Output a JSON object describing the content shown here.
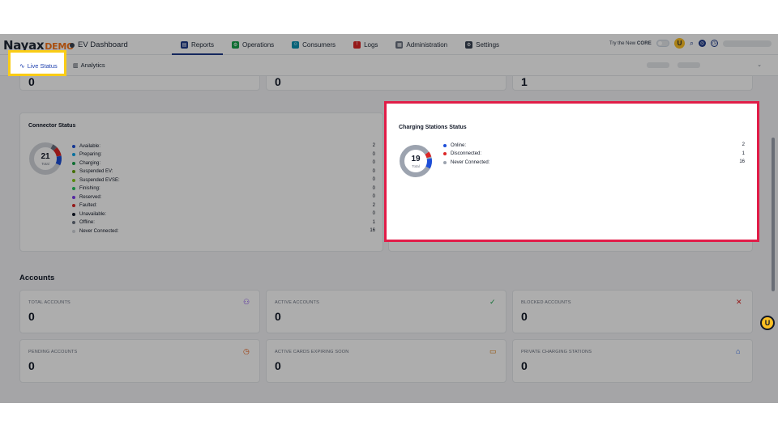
{
  "header": {
    "logo_main": "Nayax",
    "logo_demo": "DEMO",
    "app_title": "EV Dashboard",
    "nav": [
      {
        "label": "Reports",
        "icon": "reports-icon",
        "color": "#1e3a8a",
        "active": true
      },
      {
        "label": "Operations",
        "icon": "operations-icon",
        "color": "#16a34a"
      },
      {
        "label": "Consumers",
        "icon": "consumers-icon",
        "color": "#0891b2"
      },
      {
        "label": "Logs",
        "icon": "logs-icon",
        "color": "#dc2626"
      },
      {
        "label": "Administration",
        "icon": "administration-icon",
        "color": "#6b7280"
      },
      {
        "label": "Settings",
        "icon": "settings-icon",
        "color": "#374151"
      }
    ],
    "try_new": "Try the New",
    "core": "CORE"
  },
  "subnav": {
    "live_status": "Live Status",
    "analytics": "Analytics"
  },
  "top_values": [
    "0",
    "0",
    "1"
  ],
  "connector_status": {
    "title": "Connector Status",
    "total": "21",
    "total_label": "Total",
    "items": [
      {
        "label": "Available:",
        "value": "2",
        "color": "#1d4ed8"
      },
      {
        "label": "Preparing:",
        "value": "0",
        "color": "#0ea5e9"
      },
      {
        "label": "Charging:",
        "value": "0",
        "color": "#16a34a"
      },
      {
        "label": "Suspended EV:",
        "value": "0",
        "color": "#65a30d"
      },
      {
        "label": "Suspended EVSE:",
        "value": "0",
        "color": "#84cc16"
      },
      {
        "label": "Finishing:",
        "value": "0",
        "color": "#22c55e"
      },
      {
        "label": "Reserved:",
        "value": "0",
        "color": "#7c3aed"
      },
      {
        "label": "Faulted:",
        "value": "2",
        "color": "#dc2626"
      },
      {
        "label": "Unavailable:",
        "value": "0",
        "color": "#111827"
      },
      {
        "label": "Offline:",
        "value": "1",
        "color": "#6b7280"
      },
      {
        "label": "Never Connected:",
        "value": "16",
        "color": "#d1d5db"
      }
    ]
  },
  "station_status": {
    "title": "Charging Stations Status",
    "total": "19",
    "total_label": "Total",
    "items": [
      {
        "label": "Online:",
        "value": "2",
        "color": "#1d4ed8"
      },
      {
        "label": "Disconnected:",
        "value": "1",
        "color": "#dc2626"
      },
      {
        "label": "Never Connected:",
        "value": "16",
        "color": "#9ca3af"
      }
    ]
  },
  "accounts": {
    "title": "Accounts",
    "cards": [
      {
        "label": "TOTAL ACCOUNTS",
        "value": "0",
        "icon": "users-icon",
        "color": "#7c3aed"
      },
      {
        "label": "ACTIVE ACCOUNTS",
        "value": "0",
        "icon": "user-check-icon",
        "color": "#16a34a"
      },
      {
        "label": "BLOCKED ACCOUNTS",
        "value": "0",
        "icon": "user-x-icon",
        "color": "#dc2626"
      },
      {
        "label": "PENDING ACCOUNTS",
        "value": "0",
        "icon": "clock-icon",
        "color": "#ea580c"
      },
      {
        "label": "ACTIVE CARDS EXPIRING SOON",
        "value": "0",
        "icon": "card-icon",
        "color": "#d97706"
      },
      {
        "label": "PRIVATE CHARGING STATIONS",
        "value": "0",
        "icon": "home-icon",
        "color": "#2563eb"
      }
    ]
  }
}
